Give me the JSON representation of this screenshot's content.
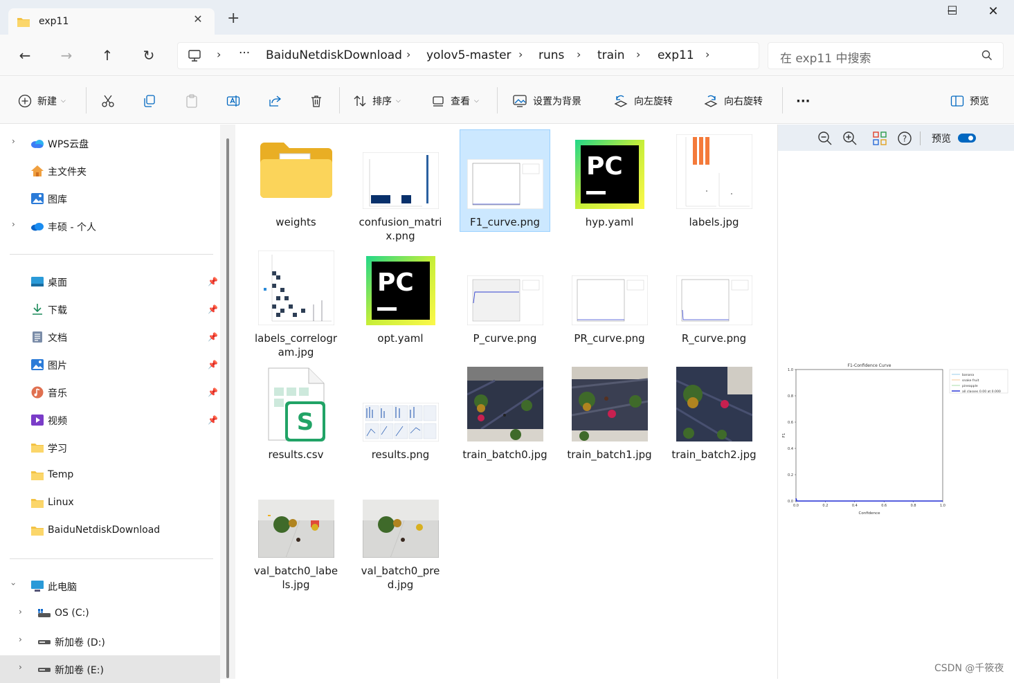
{
  "tab": {
    "title": "exp11",
    "close": "✕",
    "new": "+"
  },
  "window": {
    "minimize": "─",
    "maximize": "☐",
    "close": "✕"
  },
  "nav": {
    "back": "←",
    "forward": "→",
    "up": "↑",
    "refresh": "↻"
  },
  "address": {
    "more": "···",
    "crumbs": [
      "BaiduNetdiskDownload",
      "yolov5-master",
      "runs",
      "train",
      "exp11"
    ]
  },
  "search": {
    "placeholder": "在 exp11 中搜索"
  },
  "toolbar": {
    "new": "新建",
    "sort": "排序",
    "view": "查看",
    "set_bg": "设置为背景",
    "rotate_left": "向左旋转",
    "rotate_right": "向右旋转",
    "more": "···",
    "preview": "预览"
  },
  "sidebar": {
    "wps": "WPS云盘",
    "home": "主文件夹",
    "gallery": "图库",
    "onedrive": "丰硕 - 个人",
    "desktop": "桌面",
    "downloads": "下载",
    "documents": "文档",
    "pictures": "图片",
    "music": "音乐",
    "videos": "视频",
    "study": "学习",
    "temp": "Temp",
    "linux": "Linux",
    "baidu": "BaiduNetdiskDownload",
    "thispc": "此电脑",
    "c": "OS (C:)",
    "d": "新加卷 (D:)",
    "e": "新加卷 (E:)"
  },
  "files": [
    {
      "name": "weights"
    },
    {
      "name": "confusion_matrix.png"
    },
    {
      "name": "F1_curve.png"
    },
    {
      "name": "hyp.yaml"
    },
    {
      "name": "labels.jpg"
    },
    {
      "name": "labels_correlogram.jpg"
    },
    {
      "name": "opt.yaml"
    },
    {
      "name": "P_curve.png"
    },
    {
      "name": "PR_curve.png"
    },
    {
      "name": "R_curve.png"
    },
    {
      "name": "results.csv"
    },
    {
      "name": "results.png"
    },
    {
      "name": "train_batch0.jpg"
    },
    {
      "name": "train_batch1.jpg"
    },
    {
      "name": "train_batch2.jpg"
    },
    {
      "name": "val_batch0_labels.jpg"
    },
    {
      "name": "val_batch0_pred.jpg"
    }
  ],
  "preview_pane": {
    "label": "预览"
  },
  "chart_data": {
    "type": "line",
    "title": "F1-Confidence Curve",
    "xlabel": "Confidence",
    "ylabel": "F1",
    "xlim": [
      0,
      1
    ],
    "ylim": [
      0,
      1
    ],
    "x_ticks": [
      "0.0",
      "0.2",
      "0.4",
      "0.6",
      "0.8",
      "1.0"
    ],
    "y_ticks": [
      "0.0",
      "0.2",
      "0.4",
      "0.6",
      "0.8",
      "1.0"
    ],
    "legend_position": "outside-right",
    "series": [
      {
        "name": "banana",
        "color": "#8fc8e8",
        "x": [
          0,
          1
        ],
        "y": [
          0,
          0
        ]
      },
      {
        "name": "snake fruit",
        "color": "#f5c58a",
        "x": [
          0,
          1
        ],
        "y": [
          0,
          0
        ]
      },
      {
        "name": "pineapple",
        "color": "#9fd89f",
        "x": [
          0,
          1
        ],
        "y": [
          0,
          0
        ]
      },
      {
        "name": "all classes 0.00 at 0.000",
        "color": "#1f2bd4",
        "x": [
          0,
          0.005,
          1
        ],
        "y": [
          0.02,
          0,
          0
        ]
      }
    ]
  },
  "watermark": "CSDN @千筱夜"
}
